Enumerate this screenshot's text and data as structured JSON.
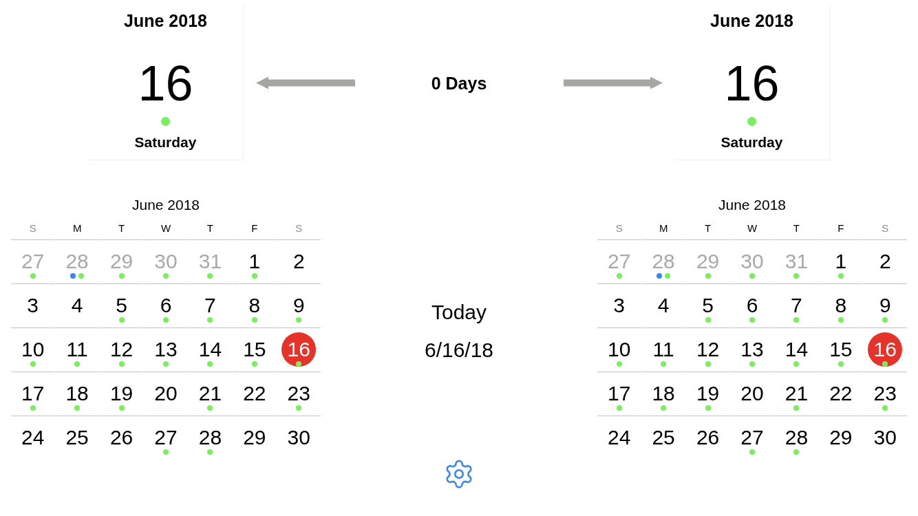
{
  "date_cards": [
    {
      "month": "June 2018",
      "day": "16",
      "dot": {
        "color": "#7aef5e"
      },
      "weekday": "Saturday"
    },
    {
      "month": "June 2018",
      "day": "16",
      "dot": {
        "color": "#7aef5e"
      },
      "weekday": "Saturday"
    }
  ],
  "difference": {
    "label": "0 Days"
  },
  "today": {
    "label": "Today",
    "date": "6/16/18"
  },
  "calendars": [
    {
      "title": "June 2018",
      "weekdays": [
        {
          "label": "S",
          "weekend": true
        },
        {
          "label": "M",
          "weekend": false
        },
        {
          "label": "T",
          "weekend": false
        },
        {
          "label": "W",
          "weekend": false
        },
        {
          "label": "T",
          "weekend": false
        },
        {
          "label": "F",
          "weekend": false
        },
        {
          "label": "S",
          "weekend": true
        }
      ],
      "weeks": [
        {
          "days": [
            {
              "label": "27",
              "outside": true,
              "selected": false,
              "dots": [
                {
                  "color": "#7aef5e"
                }
              ]
            },
            {
              "label": "28",
              "outside": true,
              "selected": false,
              "dots": [
                {
                  "color": "#3d85f2"
                },
                {
                  "color": "#7aef5e"
                }
              ]
            },
            {
              "label": "29",
              "outside": true,
              "selected": false,
              "dots": [
                {
                  "color": "#7aef5e"
                }
              ]
            },
            {
              "label": "30",
              "outside": true,
              "selected": false,
              "dots": [
                {
                  "color": "#7aef5e"
                }
              ]
            },
            {
              "label": "31",
              "outside": true,
              "selected": false,
              "dots": [
                {
                  "color": "#7aef5e"
                }
              ]
            },
            {
              "label": "1",
              "outside": false,
              "selected": false,
              "dots": [
                {
                  "color": "#7aef5e"
                }
              ]
            },
            {
              "label": "2",
              "outside": false,
              "selected": false
            }
          ]
        },
        {
          "days": [
            {
              "label": "3",
              "outside": false,
              "selected": false
            },
            {
              "label": "4",
              "outside": false,
              "selected": false
            },
            {
              "label": "5",
              "outside": false,
              "selected": false,
              "dots": [
                {
                  "color": "#7aef5e"
                }
              ]
            },
            {
              "label": "6",
              "outside": false,
              "selected": false,
              "dots": [
                {
                  "color": "#7aef5e"
                }
              ]
            },
            {
              "label": "7",
              "outside": false,
              "selected": false,
              "dots": [
                {
                  "color": "#7aef5e"
                }
              ]
            },
            {
              "label": "8",
              "outside": false,
              "selected": false,
              "dots": [
                {
                  "color": "#7aef5e"
                }
              ]
            },
            {
              "label": "9",
              "outside": false,
              "selected": false,
              "dots": [
                {
                  "color": "#7aef5e"
                }
              ]
            }
          ]
        },
        {
          "days": [
            {
              "label": "10",
              "outside": false,
              "selected": false,
              "dots": [
                {
                  "color": "#7aef5e"
                }
              ]
            },
            {
              "label": "11",
              "outside": false,
              "selected": false,
              "dots": [
                {
                  "color": "#7aef5e"
                }
              ]
            },
            {
              "label": "12",
              "outside": false,
              "selected": false,
              "dots": [
                {
                  "color": "#7aef5e"
                }
              ]
            },
            {
              "label": "13",
              "outside": false,
              "selected": false,
              "dots": [
                {
                  "color": "#7aef5e"
                }
              ]
            },
            {
              "label": "14",
              "outside": false,
              "selected": false,
              "dots": [
                {
                  "color": "#7aef5e"
                }
              ]
            },
            {
              "label": "15",
              "outside": false,
              "selected": false,
              "dots": [
                {
                  "color": "#7aef5e"
                }
              ]
            },
            {
              "label": "16",
              "outside": false,
              "selected": true,
              "dots": [
                {
                  "color": "#7aef5e"
                }
              ]
            }
          ]
        },
        {
          "days": [
            {
              "label": "17",
              "outside": false,
              "selected": false,
              "dots": [
                {
                  "color": "#7aef5e"
                }
              ]
            },
            {
              "label": "18",
              "outside": false,
              "selected": false,
              "dots": [
                {
                  "color": "#7aef5e"
                }
              ]
            },
            {
              "label": "19",
              "outside": false,
              "selected": false,
              "dots": [
                {
                  "color": "#7aef5e"
                }
              ]
            },
            {
              "label": "20",
              "outside": false,
              "selected": false
            },
            {
              "label": "21",
              "outside": false,
              "selected": false,
              "dots": [
                {
                  "color": "#7aef5e"
                }
              ]
            },
            {
              "label": "22",
              "outside": false,
              "selected": false
            },
            {
              "label": "23",
              "outside": false,
              "selected": false,
              "dots": [
                {
                  "color": "#7aef5e"
                }
              ]
            }
          ]
        },
        {
          "days": [
            {
              "label": "24",
              "outside": false,
              "selected": false
            },
            {
              "label": "25",
              "outside": false,
              "selected": false
            },
            {
              "label": "26",
              "outside": false,
              "selected": false
            },
            {
              "label": "27",
              "outside": false,
              "selected": false,
              "dots": [
                {
                  "color": "#7aef5e"
                }
              ]
            },
            {
              "label": "28",
              "outside": false,
              "selected": false,
              "dots": [
                {
                  "color": "#7aef5e"
                }
              ]
            },
            {
              "label": "29",
              "outside": false,
              "selected": false
            },
            {
              "label": "30",
              "outside": false,
              "selected": false
            }
          ]
        }
      ]
    },
    {
      "title": "June 2018",
      "weekdays": [
        {
          "label": "S",
          "weekend": true
        },
        {
          "label": "M",
          "weekend": false
        },
        {
          "label": "T",
          "weekend": false
        },
        {
          "label": "W",
          "weekend": false
        },
        {
          "label": "T",
          "weekend": false
        },
        {
          "label": "F",
          "weekend": false
        },
        {
          "label": "S",
          "weekend": true
        }
      ],
      "weeks": [
        {
          "days": [
            {
              "label": "27",
              "outside": true,
              "selected": false,
              "dots": [
                {
                  "color": "#7aef5e"
                }
              ]
            },
            {
              "label": "28",
              "outside": true,
              "selected": false,
              "dots": [
                {
                  "color": "#3d85f2"
                },
                {
                  "color": "#7aef5e"
                }
              ]
            },
            {
              "label": "29",
              "outside": true,
              "selected": false,
              "dots": [
                {
                  "color": "#7aef5e"
                }
              ]
            },
            {
              "label": "30",
              "outside": true,
              "selected": false,
              "dots": [
                {
                  "color": "#7aef5e"
                }
              ]
            },
            {
              "label": "31",
              "outside": true,
              "selected": false,
              "dots": [
                {
                  "color": "#7aef5e"
                }
              ]
            },
            {
              "label": "1",
              "outside": false,
              "selected": false,
              "dots": [
                {
                  "color": "#7aef5e"
                }
              ]
            },
            {
              "label": "2",
              "outside": false,
              "selected": false
            }
          ]
        },
        {
          "days": [
            {
              "label": "3",
              "outside": false,
              "selected": false
            },
            {
              "label": "4",
              "outside": false,
              "selected": false
            },
            {
              "label": "5",
              "outside": false,
              "selected": false,
              "dots": [
                {
                  "color": "#7aef5e"
                }
              ]
            },
            {
              "label": "6",
              "outside": false,
              "selected": false,
              "dots": [
                {
                  "color": "#7aef5e"
                }
              ]
            },
            {
              "label": "7",
              "outside": false,
              "selected": false,
              "dots": [
                {
                  "color": "#7aef5e"
                }
              ]
            },
            {
              "label": "8",
              "outside": false,
              "selected": false,
              "dots": [
                {
                  "color": "#7aef5e"
                }
              ]
            },
            {
              "label": "9",
              "outside": false,
              "selected": false,
              "dots": [
                {
                  "color": "#7aef5e"
                }
              ]
            }
          ]
        },
        {
          "days": [
            {
              "label": "10",
              "outside": false,
              "selected": false,
              "dots": [
                {
                  "color": "#7aef5e"
                }
              ]
            },
            {
              "label": "11",
              "outside": false,
              "selected": false,
              "dots": [
                {
                  "color": "#7aef5e"
                }
              ]
            },
            {
              "label": "12",
              "outside": false,
              "selected": false,
              "dots": [
                {
                  "color": "#7aef5e"
                }
              ]
            },
            {
              "label": "13",
              "outside": false,
              "selected": false,
              "dots": [
                {
                  "color": "#7aef5e"
                }
              ]
            },
            {
              "label": "14",
              "outside": false,
              "selected": false,
              "dots": [
                {
                  "color": "#7aef5e"
                }
              ]
            },
            {
              "label": "15",
              "outside": false,
              "selected": false,
              "dots": [
                {
                  "color": "#7aef5e"
                }
              ]
            },
            {
              "label": "16",
              "outside": false,
              "selected": true,
              "dots": [
                {
                  "color": "#7aef5e"
                }
              ]
            }
          ]
        },
        {
          "days": [
            {
              "label": "17",
              "outside": false,
              "selected": false,
              "dots": [
                {
                  "color": "#7aef5e"
                }
              ]
            },
            {
              "label": "18",
              "outside": false,
              "selected": false,
              "dots": [
                {
                  "color": "#7aef5e"
                }
              ]
            },
            {
              "label": "19",
              "outside": false,
              "selected": false,
              "dots": [
                {
                  "color": "#7aef5e"
                }
              ]
            },
            {
              "label": "20",
              "outside": false,
              "selected": false
            },
            {
              "label": "21",
              "outside": false,
              "selected": false,
              "dots": [
                {
                  "color": "#7aef5e"
                }
              ]
            },
            {
              "label": "22",
              "outside": false,
              "selected": false
            },
            {
              "label": "23",
              "outside": false,
              "selected": false,
              "dots": [
                {
                  "color": "#7aef5e"
                }
              ]
            }
          ]
        },
        {
          "days": [
            {
              "label": "24",
              "outside": false,
              "selected": false
            },
            {
              "label": "25",
              "outside": false,
              "selected": false
            },
            {
              "label": "26",
              "outside": false,
              "selected": false
            },
            {
              "label": "27",
              "outside": false,
              "selected": false,
              "dots": [
                {
                  "color": "#7aef5e"
                }
              ]
            },
            {
              "label": "28",
              "outside": false,
              "selected": false,
              "dots": [
                {
                  "color": "#7aef5e"
                }
              ]
            },
            {
              "label": "29",
              "outside": false,
              "selected": false
            },
            {
              "label": "30",
              "outside": false,
              "selected": false
            }
          ]
        }
      ]
    }
  ]
}
